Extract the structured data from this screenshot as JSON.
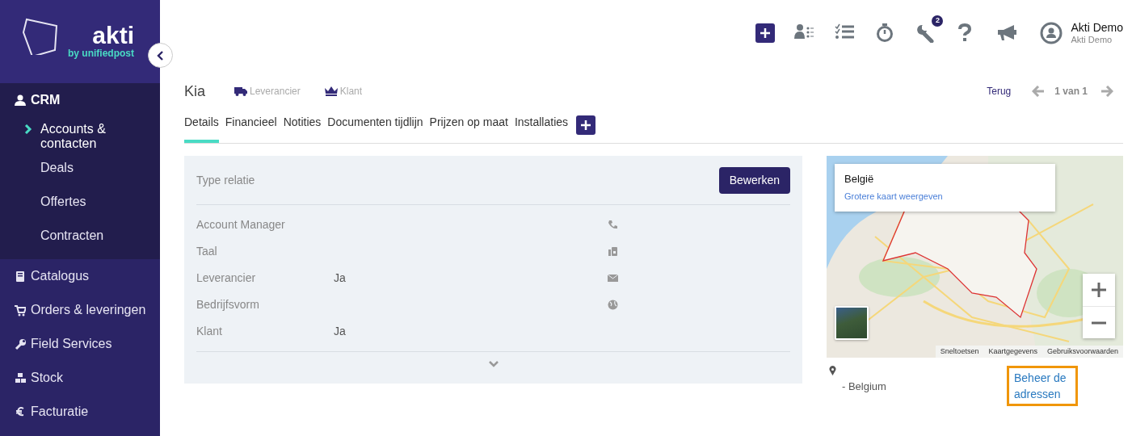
{
  "sidebar": {
    "logo": {
      "name": "akti",
      "tagline": "by unifiedpost"
    },
    "items": [
      {
        "label": "CRM",
        "expanded": true,
        "children": [
          {
            "label": "Accounts & contacten",
            "selected": true
          },
          {
            "label": "Deals",
            "selected": false
          },
          {
            "label": "Offertes",
            "selected": false
          },
          {
            "label": "Contracten",
            "selected": false
          }
        ]
      },
      {
        "label": "Catalogus",
        "expanded": false
      },
      {
        "label": "Orders & leveringen",
        "expanded": false
      },
      {
        "label": "Field Services",
        "expanded": false
      },
      {
        "label": "Stock",
        "expanded": false
      },
      {
        "label": "Facturatie",
        "expanded": false
      }
    ]
  },
  "toolbar": {
    "badge": "2",
    "user": {
      "name": "Akti Demo",
      "company": "Akti Demo"
    }
  },
  "record": {
    "title": "Kia",
    "tags": [
      "Leverancier",
      "Klant"
    ],
    "back": "Terug",
    "pager": "1 van 1"
  },
  "tabs": [
    {
      "label": "Details",
      "selected": true
    },
    {
      "label": "Financieel",
      "selected": false
    },
    {
      "label": "Notities",
      "selected": false
    },
    {
      "label": "Documenten tijdlijn",
      "selected": false
    },
    {
      "label": "Prijzen op maat",
      "selected": false
    },
    {
      "label": "Installaties",
      "selected": false
    }
  ],
  "panel": {
    "heading": "Type relatie",
    "button": "Bewerken",
    "fields": [
      {
        "label": "Account Manager"
      },
      {
        "label": "Taal"
      },
      {
        "label": "Leverancier",
        "value": "Ja"
      },
      {
        "label": "Bedrijfsvorm"
      },
      {
        "label": "Klant",
        "value": "Ja"
      }
    ]
  },
  "map": {
    "info_title": "België",
    "info_link": "Grotere kaart weergeven",
    "footer_links": [
      "Sneltoetsen",
      "Kaartgegevens",
      "Gebruiksvoorwaarden"
    ]
  },
  "address": {
    "line": "- Belgium",
    "link": "Beheer de adressen",
    "focused": true
  }
}
